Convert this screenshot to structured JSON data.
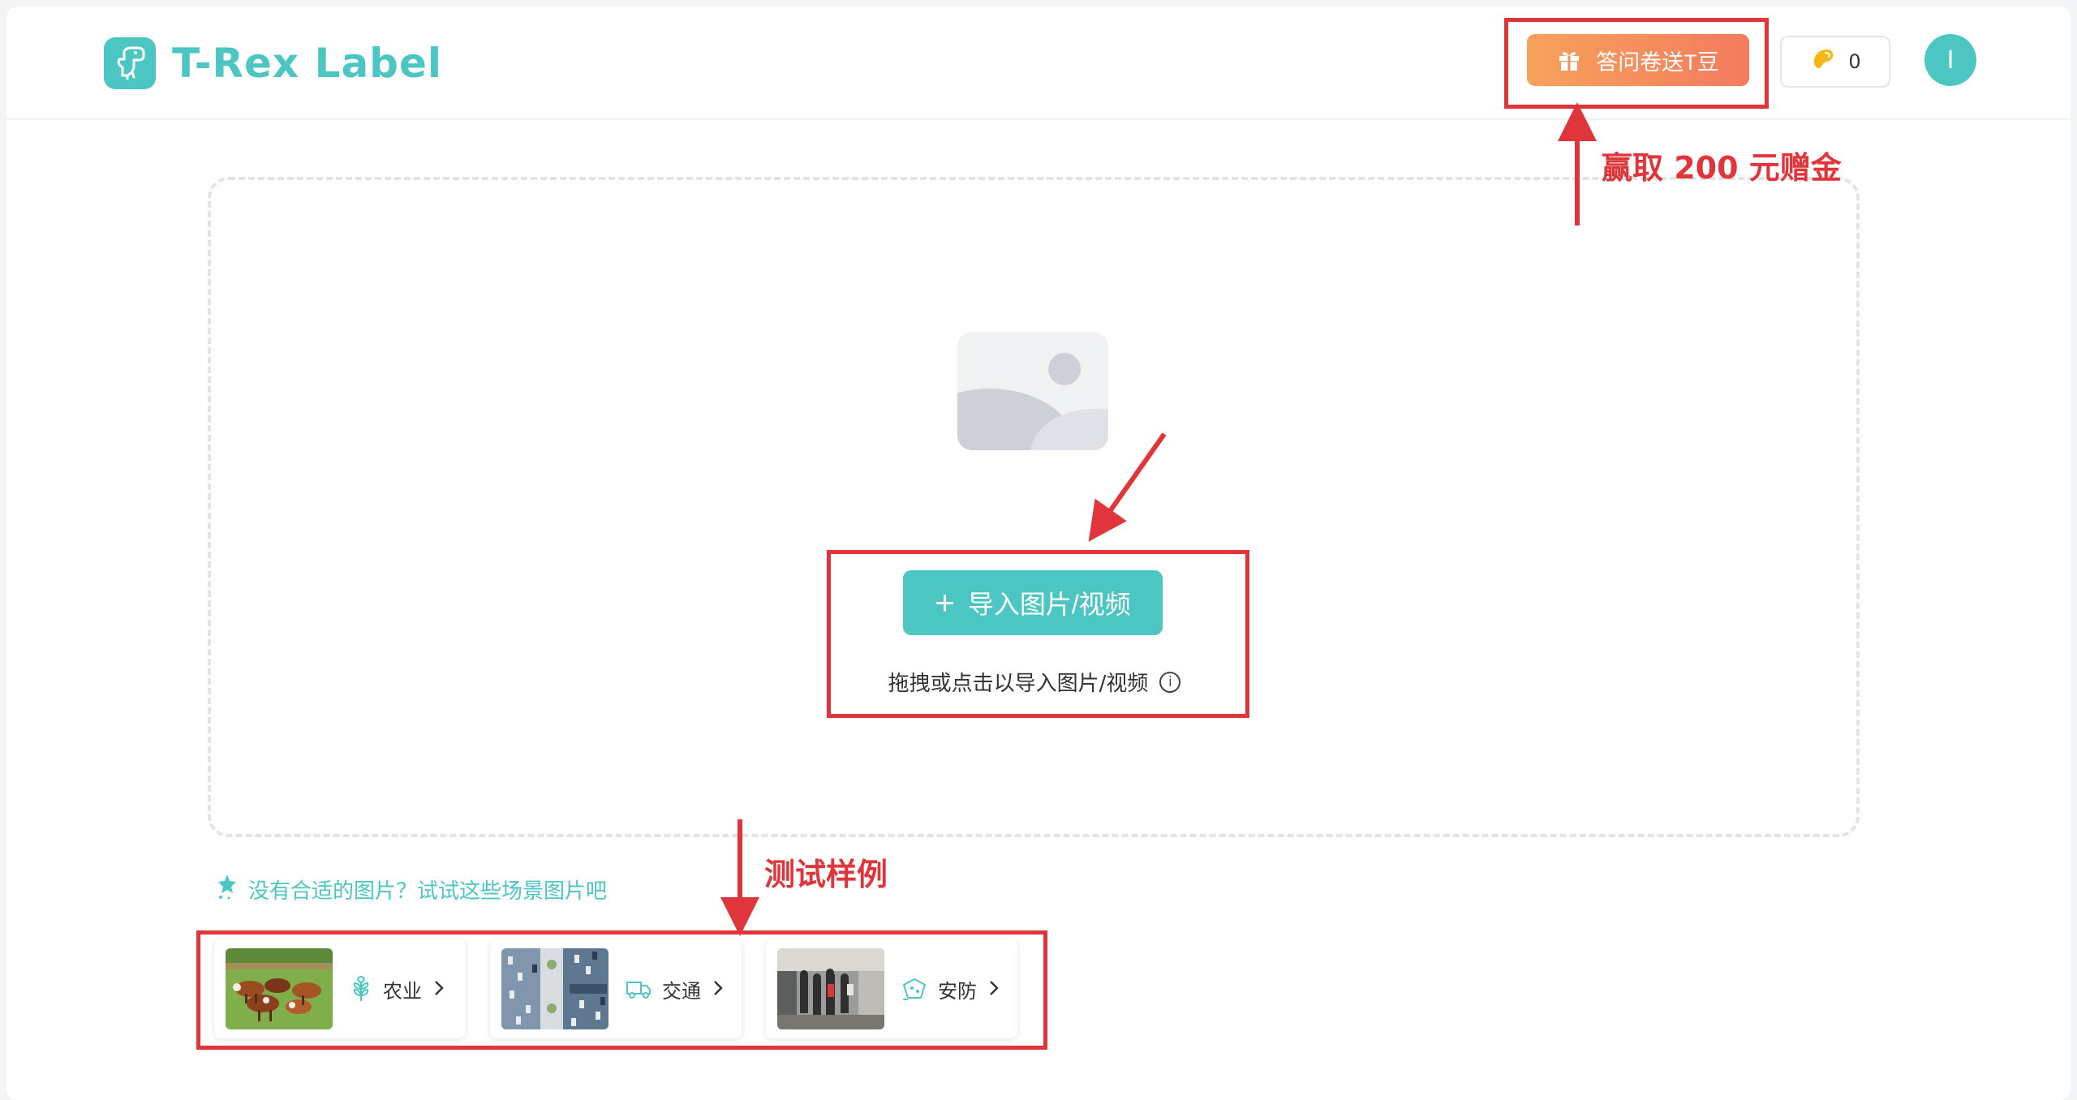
{
  "header": {
    "logo_text": "T-Rex Label",
    "survey_button": "答问卷送T豆",
    "coin_count": "0",
    "avatar_initial": "I"
  },
  "upload": {
    "import_button": "导入图片/视频",
    "hint": "拖拽或点击以导入图片/视频"
  },
  "samples": {
    "tip": "没有合适的图片？试试这些场景图片吧",
    "items": [
      {
        "label": "农业",
        "icon": "wheat-icon"
      },
      {
        "label": "交通",
        "icon": "truck-icon"
      },
      {
        "label": "安防",
        "icon": "shield-icon"
      }
    ]
  },
  "annotations": {
    "bonus": "赢取 200 元赠金",
    "samples": "测试样例"
  },
  "colors": {
    "brand": "#4cc6c2",
    "survey_gradient_start": "#f7a25c",
    "survey_gradient_end": "#f47b5e",
    "annotation_red": "#e0363b"
  }
}
